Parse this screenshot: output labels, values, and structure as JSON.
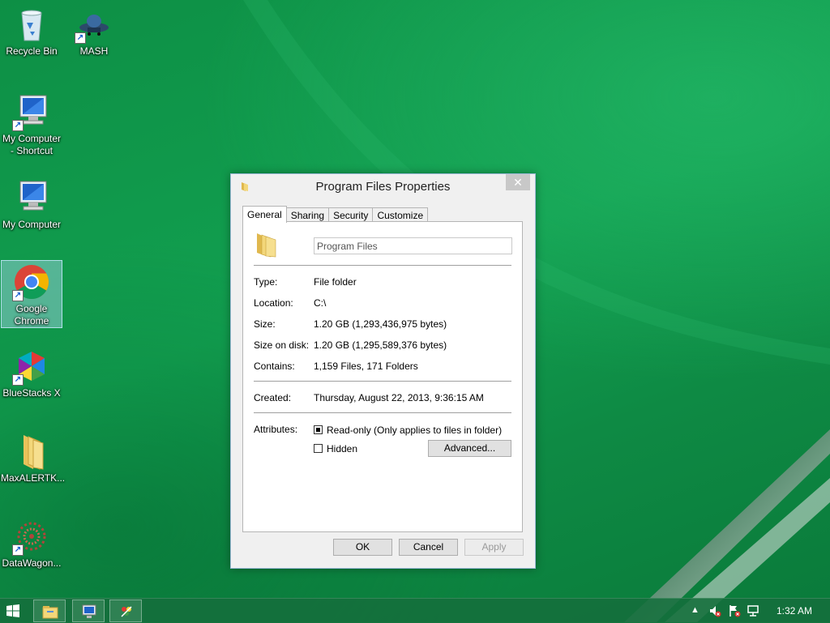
{
  "desktop": {
    "icons": [
      {
        "label": "Recycle Bin",
        "icon": "recycle-bin-icon"
      },
      {
        "label": "MASH",
        "icon": "mash-icon"
      },
      {
        "label": "My Computer\n- Shortcut",
        "icon": "computer-icon"
      },
      {
        "label": "My Computer",
        "icon": "computer-icon"
      },
      {
        "label": "Google\nChrome",
        "icon": "chrome-icon"
      },
      {
        "label": "BlueStacks X",
        "icon": "bluestacks-icon"
      },
      {
        "label": "MaxALERTK...",
        "icon": "folder-icon"
      },
      {
        "label": "DataWagon...",
        "icon": "datawagon-icon"
      }
    ]
  },
  "dialog": {
    "title": "Program Files Properties",
    "close_label": "✕",
    "tabs": [
      "General",
      "Sharing",
      "Security",
      "Customize"
    ],
    "active_tab": "General",
    "folder_name": "Program Files",
    "rows": {
      "type": {
        "label": "Type:",
        "value": "File folder"
      },
      "location": {
        "label": "Location:",
        "value": "C:\\"
      },
      "size": {
        "label": "Size:",
        "value": "1.20 GB (1,293,436,975 bytes)"
      },
      "size_on_disk": {
        "label": "Size on disk:",
        "value": "1.20 GB (1,295,589,376 bytes)"
      },
      "contains": {
        "label": "Contains:",
        "value": "1,159 Files, 171 Folders"
      },
      "created": {
        "label": "Created:",
        "value": "Thursday, August 22, 2013, 9:36:15 AM"
      }
    },
    "attributes": {
      "label": "Attributes:",
      "readonly_label": "Read-only (Only applies to files in folder)",
      "readonly_checked": true,
      "hidden_label": "Hidden",
      "hidden_checked": false,
      "advanced_label": "Advanced..."
    },
    "buttons": {
      "ok": "OK",
      "cancel": "Cancel",
      "apply": "Apply"
    }
  },
  "taskbar": {
    "items": [
      "file-explorer-icon",
      "remote-desktop-icon",
      "paint-icon"
    ],
    "clock": "1:32 AM"
  }
}
